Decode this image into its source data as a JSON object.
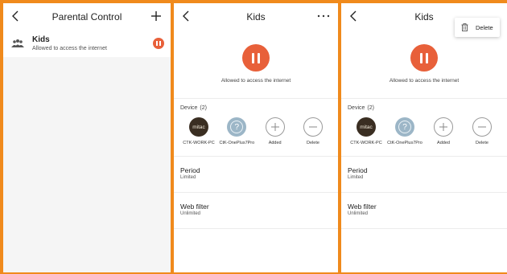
{
  "screen1": {
    "title": "Parental Control",
    "items": [
      {
        "name": "Kids",
        "status": "Allowed to access the internet"
      }
    ]
  },
  "screen2": {
    "title": "Kids",
    "status": "Allowed to access the internet",
    "device_label": "Device",
    "device_count": "(2)",
    "devices": [
      {
        "label": "CTK-WORK-PC",
        "avatar_text": "mitac"
      },
      {
        "label": "CtK-OnePlus7Pro"
      },
      {
        "label": "Added"
      },
      {
        "label": "Delete"
      }
    ],
    "period": {
      "title": "Period",
      "value": "Limited"
    },
    "webfilter": {
      "title": "Web filter",
      "value": "Unlimited"
    }
  },
  "screen3": {
    "title": "Kids",
    "status": "Allowed to access the internet",
    "device_label": "Device",
    "device_count": "(2)",
    "devices": [
      {
        "label": "CTK-WORK-PC",
        "avatar_text": "mitac"
      },
      {
        "label": "CtK-OnePlus7Pro"
      },
      {
        "label": "Added"
      },
      {
        "label": "Delete"
      }
    ],
    "period": {
      "title": "Period",
      "value": "Limited"
    },
    "webfilter": {
      "title": "Web filter",
      "value": "Unlimited"
    },
    "menu": {
      "delete_label": "Delete"
    }
  },
  "colors": {
    "frame": "#f08a1c",
    "accent": "#e8603a",
    "device_dark": "#3a2e22",
    "device_blue": "#9cb6c7"
  }
}
